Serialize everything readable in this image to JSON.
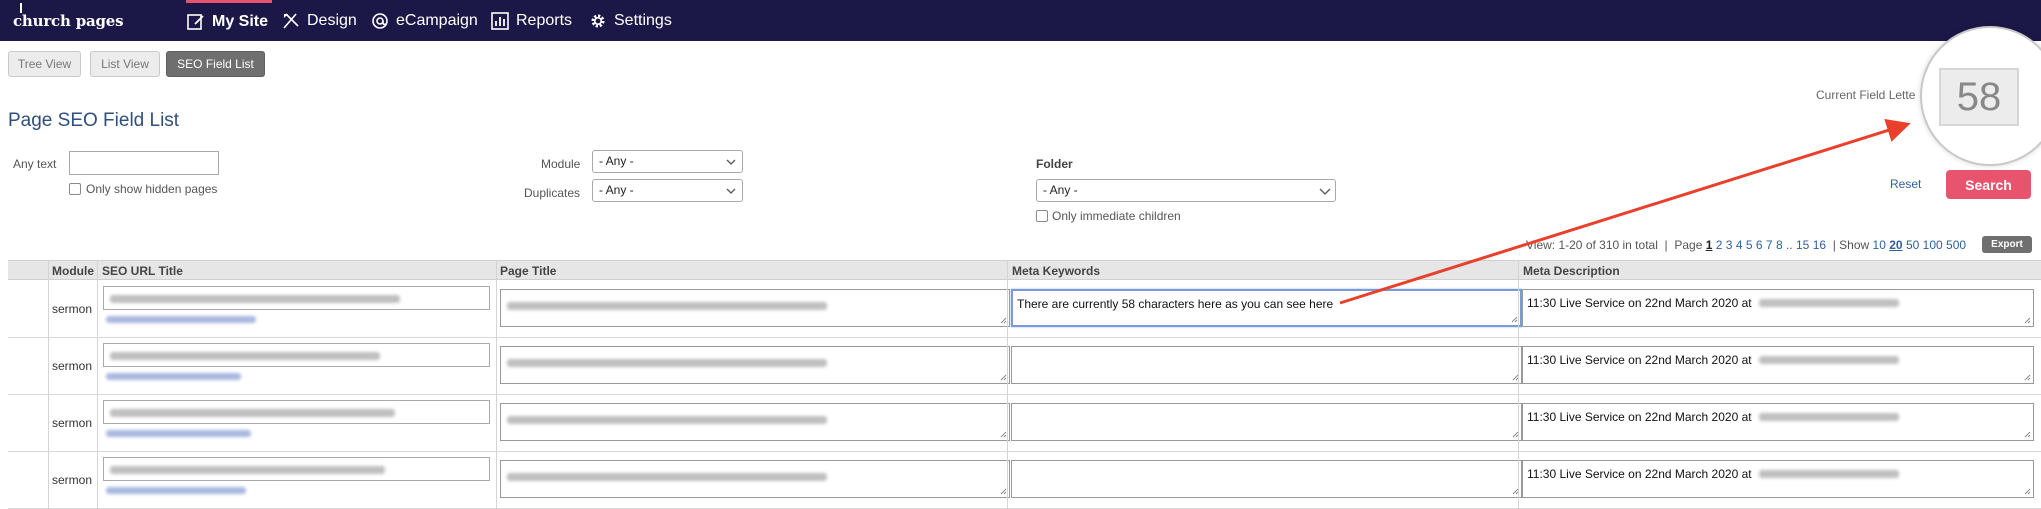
{
  "brand": {
    "name": "church pages"
  },
  "nav": {
    "items": [
      {
        "label": "My Site",
        "icon": "edit-page-icon",
        "active": true
      },
      {
        "label": "Design",
        "icon": "design-tools-icon"
      },
      {
        "label": "eCampaign",
        "icon": "at-sign-icon"
      },
      {
        "label": "Reports",
        "icon": "bar-chart-icon"
      },
      {
        "label": "Settings",
        "icon": "gear-icon"
      }
    ],
    "accent_color": "#e8546e",
    "background_color": "#1b1848"
  },
  "views": [
    {
      "label": "Tree View"
    },
    {
      "label": "List View"
    },
    {
      "label": "SEO Field List",
      "selected": true
    }
  ],
  "page_title": "Page SEO Field List",
  "current_field": {
    "label": "Current Field Lette",
    "value": "58"
  },
  "filters": {
    "any_text_label": "Any text",
    "any_text_value": "",
    "hidden_pages_label": "Only show hidden pages",
    "module_label": "Module",
    "module_value": "- Any -",
    "duplicates_label": "Duplicates",
    "duplicates_value": "- Any -",
    "folder_label": "Folder",
    "folder_value": "- Any -",
    "immediate_children_label": "Only immediate children"
  },
  "actions": {
    "reset": "Reset",
    "search": "Search",
    "export": "Export"
  },
  "pagination": {
    "summary": "View: 1-20 of 310 in total",
    "sep": "|",
    "page_label": "Page",
    "current_page": "1",
    "pages": [
      "2",
      "3",
      "4",
      "5",
      "6",
      "7",
      "8",
      "..",
      "15",
      "16"
    ],
    "show_label": "| Show",
    "sizes": [
      "10",
      "20",
      "50",
      "100",
      "500"
    ],
    "current_size": "20"
  },
  "table": {
    "headers": {
      "module": "Module",
      "seo_url_title": "SEO URL Title",
      "page_title": "Page Title",
      "meta_keywords": "Meta Keywords",
      "meta_description": "Meta Description"
    },
    "rows": [
      {
        "module": "sermon",
        "meta_keywords": "There are currently 58 characters here as you can see here",
        "meta_description": "11:30 Live Service on 22nd March 2020 at"
      },
      {
        "module": "sermon",
        "meta_keywords": "",
        "meta_description": "11:30 Live Service on 22nd March 2020 at"
      },
      {
        "module": "sermon",
        "meta_keywords": "",
        "meta_description": "11:30 Live Service on 22nd March 2020 at"
      },
      {
        "module": "sermon",
        "meta_keywords": "",
        "meta_description": "11:30 Live Service on 22nd March 2020 at"
      }
    ]
  },
  "annotation": {
    "arrow_color": "#e8402a"
  }
}
